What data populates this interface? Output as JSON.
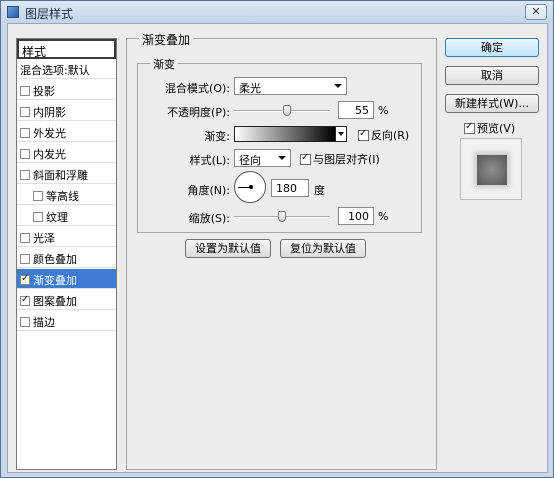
{
  "window": {
    "title": "图层样式",
    "close_label": "✕"
  },
  "stylelist": {
    "header": "样式",
    "items": [
      {
        "label": "混合选项:默认",
        "checkbox": false,
        "checked": false,
        "selected": false,
        "indent": false
      },
      {
        "label": "投影",
        "checkbox": true,
        "checked": false,
        "selected": false,
        "indent": false
      },
      {
        "label": "内阴影",
        "checkbox": true,
        "checked": false,
        "selected": false,
        "indent": false
      },
      {
        "label": "外发光",
        "checkbox": true,
        "checked": false,
        "selected": false,
        "indent": false
      },
      {
        "label": "内发光",
        "checkbox": true,
        "checked": false,
        "selected": false,
        "indent": false
      },
      {
        "label": "斜面和浮雕",
        "checkbox": true,
        "checked": false,
        "selected": false,
        "indent": false
      },
      {
        "label": "等高线",
        "checkbox": true,
        "checked": false,
        "selected": false,
        "indent": true
      },
      {
        "label": "纹理",
        "checkbox": true,
        "checked": false,
        "selected": false,
        "indent": true
      },
      {
        "label": "光泽",
        "checkbox": true,
        "checked": false,
        "selected": false,
        "indent": false
      },
      {
        "label": "颜色叠加",
        "checkbox": true,
        "checked": false,
        "selected": false,
        "indent": false
      },
      {
        "label": "渐变叠加",
        "checkbox": true,
        "checked": true,
        "selected": true,
        "indent": false
      },
      {
        "label": "图案叠加",
        "checkbox": true,
        "checked": true,
        "selected": false,
        "indent": false
      },
      {
        "label": "描边",
        "checkbox": true,
        "checked": false,
        "selected": false,
        "indent": false
      }
    ]
  },
  "panel": {
    "group_title": "渐变叠加",
    "sub_title": "渐变",
    "blend_mode_label": "混合模式(O):",
    "blend_mode_value": "柔光",
    "opacity_label": "不透明度(P):",
    "opacity_value": "55",
    "opacity_unit": "%",
    "gradient_label": "渐变:",
    "reverse_label": "反向(R)",
    "reverse_checked": true,
    "style_label": "样式(L):",
    "style_value": "径向",
    "align_label": "与图层对齐(I)",
    "align_checked": true,
    "angle_label": "角度(N):",
    "angle_value": "180",
    "angle_unit": "度",
    "scale_label": "缩放(S):",
    "scale_value": "100",
    "scale_unit": "%",
    "make_default_label": "设置为默认值",
    "reset_default_label": "复位为默认值"
  },
  "actions": {
    "ok_label": "确定",
    "cancel_label": "取消",
    "new_style_label": "新建样式(W)...",
    "preview_label": "预览(V)",
    "preview_checked": true
  },
  "sliders": {
    "opacity_fraction": 0.55,
    "scale_fraction": 0.5
  }
}
